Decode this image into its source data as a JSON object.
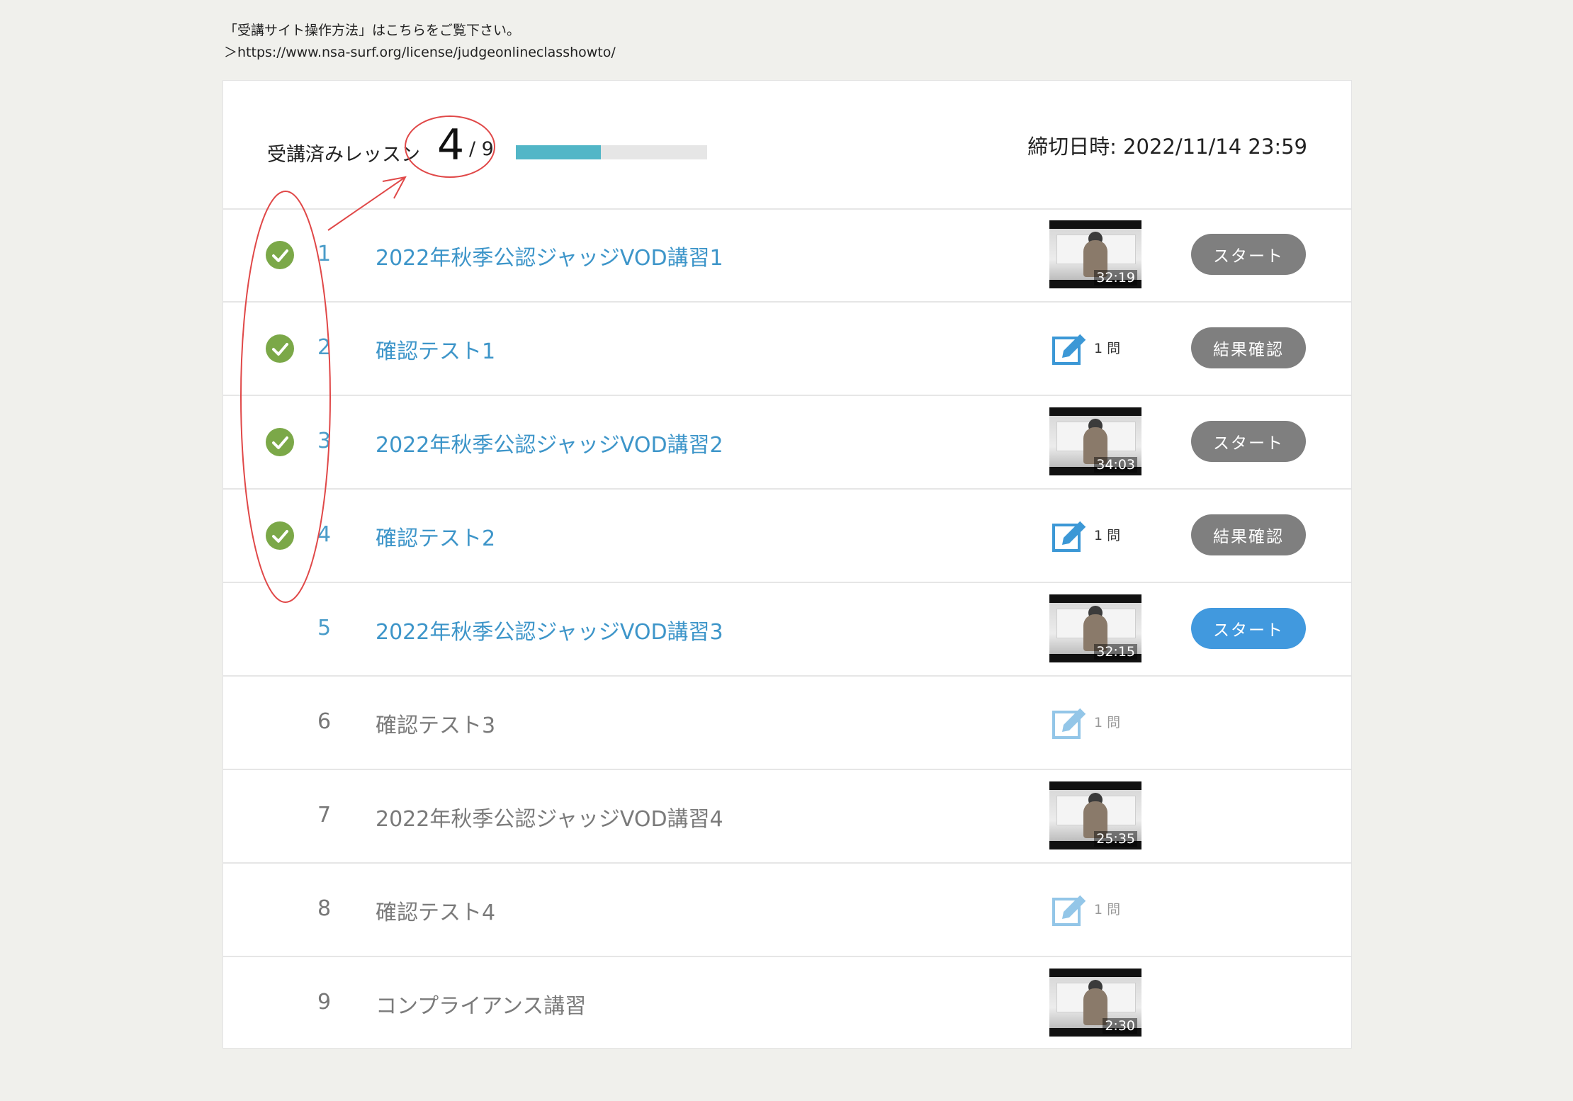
{
  "notice": {
    "line1": "「受講サイト操作方法」はこちらをご覧下さい。",
    "line2": "＞https://www.nsa-surf.org/license/judgeonlineclasshowto/"
  },
  "summary": {
    "label": "受講済みレッスン",
    "completed": "4",
    "total": "/ 9",
    "progress_fraction": 0.444,
    "deadline": "締切日時: 2022/11/14 23:59"
  },
  "lessons": [
    {
      "num": "1",
      "title": "2022年秋季公認ジャッジVOD講習1",
      "type": "video",
      "duration": "32:19",
      "done": true,
      "button": "スタート"
    },
    {
      "num": "2",
      "title": "確認テスト1",
      "type": "quiz",
      "count": "1 問",
      "done": true,
      "button": "結果確認"
    },
    {
      "num": "3",
      "title": "2022年秋季公認ジャッジVOD講習2",
      "type": "video",
      "duration": "34:03",
      "done": true,
      "button": "スタート"
    },
    {
      "num": "4",
      "title": "確認テスト2",
      "type": "quiz",
      "count": "1 問",
      "done": true,
      "button": "結果確認"
    },
    {
      "num": "5",
      "title": "2022年秋季公認ジャッジVOD講習3",
      "type": "video",
      "duration": "32:15",
      "done": false,
      "button": "スタート"
    },
    {
      "num": "6",
      "title": "確認テスト3",
      "type": "quiz",
      "count": "1 問",
      "done": false
    },
    {
      "num": "7",
      "title": "2022年秋季公認ジャッジVOD講習4",
      "type": "video",
      "duration": "25:35",
      "done": false
    },
    {
      "num": "8",
      "title": "確認テスト4",
      "type": "quiz",
      "count": "1 問",
      "done": false
    },
    {
      "num": "9",
      "title": "コンプライアンス講習",
      "type": "video",
      "duration": "2:30",
      "done": false
    }
  ],
  "colors": {
    "accent_blue": "#4199de",
    "progress": "#52b6c7",
    "check_green": "#7ba848",
    "annotation_red": "#e04848"
  },
  "icons": {
    "check": "check-circle-icon",
    "quiz": "pencil-edit-icon",
    "thumb": "video-thumbnail"
  }
}
